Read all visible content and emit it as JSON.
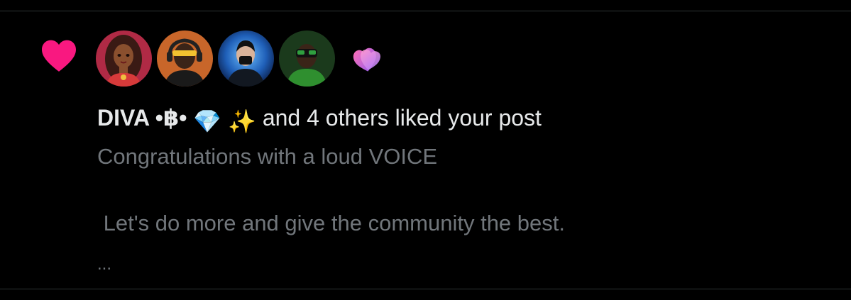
{
  "notification": {
    "type_icon": "heart-icon",
    "accent_color": "#f91880",
    "avatars": [
      {
        "icon": "avatar-woman-cartoon"
      },
      {
        "icon": "avatar-man-headphones"
      },
      {
        "icon": "avatar-masked-person"
      },
      {
        "icon": "avatar-man-vr-headset"
      }
    ],
    "more_icon": "stacked-likes-icon",
    "user_name": "DIVA •฿•",
    "user_emojis": [
      "💎",
      "✨"
    ],
    "action_text": " and 4 others liked your post",
    "post_line1": "Congratulations with a loud VOICE",
    "post_line2": " Let's do more and give the community the best.",
    "truncation": "..."
  }
}
